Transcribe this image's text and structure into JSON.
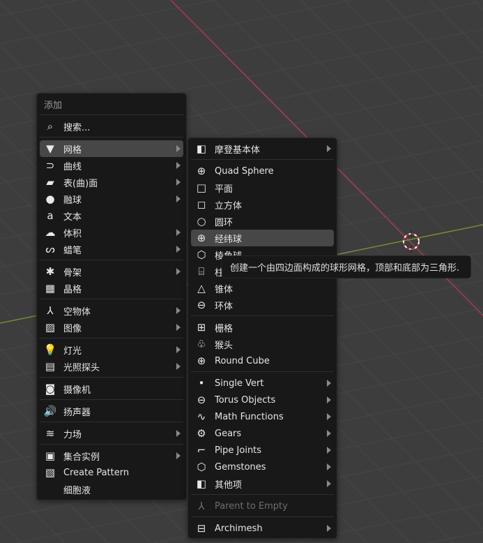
{
  "colors": {
    "viewport_bg": "#3d3d3d",
    "grid": "#4a4a4a",
    "x_axis": "#b8384f",
    "y_axis": "#7a9a2e",
    "menu_bg": "#181818",
    "highlight": "#474747"
  },
  "main_menu": {
    "title": "添加",
    "items": [
      {
        "sep": true
      },
      {
        "label": "搜索...",
        "icon": "search-icon"
      },
      {
        "sep": true
      },
      {
        "label": "网格",
        "icon": "mesh-icon",
        "submenu": true,
        "highlighted": true
      },
      {
        "label": "曲线",
        "icon": "curve-icon",
        "submenu": true
      },
      {
        "label": "表(曲)面",
        "icon": "surface-icon",
        "submenu": true
      },
      {
        "label": "融球",
        "icon": "metaball-icon",
        "submenu": true
      },
      {
        "label": "文本",
        "icon": "text-icon"
      },
      {
        "label": "体积",
        "icon": "volume-icon",
        "submenu": true
      },
      {
        "label": "蜡笔",
        "icon": "grease-pencil-icon",
        "submenu": true
      },
      {
        "sep": true
      },
      {
        "label": "骨架",
        "icon": "armature-icon",
        "submenu": true
      },
      {
        "label": "晶格",
        "icon": "lattice-icon"
      },
      {
        "sep": true
      },
      {
        "label": "空物体",
        "icon": "empty-icon",
        "submenu": true
      },
      {
        "label": "图像",
        "icon": "image-icon",
        "submenu": true
      },
      {
        "sep": true
      },
      {
        "label": "灯光",
        "icon": "light-icon",
        "submenu": true
      },
      {
        "label": "光照探头",
        "icon": "light-probe-icon",
        "submenu": true
      },
      {
        "sep": true
      },
      {
        "label": "摄像机",
        "icon": "camera-icon"
      },
      {
        "sep": true
      },
      {
        "label": "扬声器",
        "icon": "speaker-icon"
      },
      {
        "sep": true
      },
      {
        "label": "力场",
        "icon": "force-field-icon",
        "submenu": true
      },
      {
        "sep": true
      },
      {
        "label": "集合实例",
        "icon": "collection-instance-icon",
        "submenu": true
      },
      {
        "label": "Create Pattern",
        "icon": "pattern-icon"
      },
      {
        "label": "细胞液",
        "icon": "none"
      }
    ]
  },
  "sub_menu": {
    "items": [
      {
        "label": "摩登基本体",
        "icon": "modern-primitives-icon",
        "submenu": true
      },
      {
        "sep": true
      },
      {
        "label": "Quad Sphere",
        "icon": "sphere-icon"
      },
      {
        "label": "平面",
        "icon": "plane-icon"
      },
      {
        "label": "立方体",
        "icon": "cube-icon"
      },
      {
        "label": "圆环",
        "icon": "circle-icon"
      },
      {
        "label": "经纬球",
        "icon": "uv-sphere-icon",
        "highlighted": true
      },
      {
        "label": "棱角球",
        "icon": "ico-sphere-icon"
      },
      {
        "label": "柱体",
        "icon": "cylinder-icon"
      },
      {
        "label": "锥体",
        "icon": "cone-icon"
      },
      {
        "label": "环体",
        "icon": "torus-icon"
      },
      {
        "sep": true
      },
      {
        "label": "栅格",
        "icon": "grid-icon"
      },
      {
        "label": "猴头",
        "icon": "monkey-icon"
      },
      {
        "label": "Round Cube",
        "icon": "sphere-icon"
      },
      {
        "sep": true
      },
      {
        "label": "Single Vert",
        "icon": "vertex-icon",
        "submenu": true
      },
      {
        "label": "Torus Objects",
        "icon": "torus-icon",
        "submenu": true
      },
      {
        "label": "Math Functions",
        "icon": "math-icon",
        "submenu": true
      },
      {
        "label": "Gears",
        "icon": "gear-icon",
        "submenu": true
      },
      {
        "label": "Pipe Joints",
        "icon": "pipe-icon",
        "submenu": true
      },
      {
        "label": "Gemstones",
        "icon": "ico-sphere-icon",
        "submenu": true
      },
      {
        "label": "其他项",
        "icon": "modern-primitives-icon",
        "submenu": true
      },
      {
        "sep": true
      },
      {
        "label": "Parent to Empty",
        "icon": "empty-icon",
        "disabled": true
      },
      {
        "sep": true
      },
      {
        "label": "Archimesh",
        "icon": "archive-icon",
        "submenu": true
      }
    ]
  },
  "tooltip": {
    "text": "创建一个由四边面构成的球形网格，顶部和底部为三角形."
  }
}
